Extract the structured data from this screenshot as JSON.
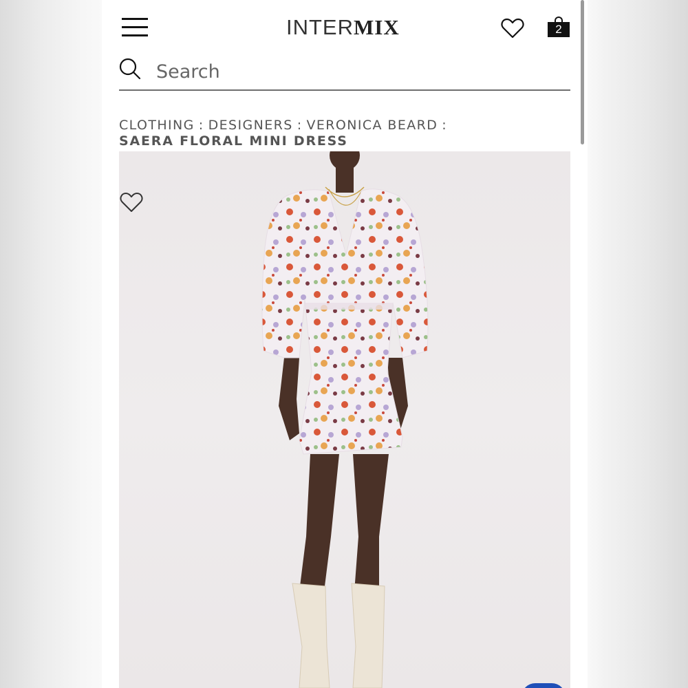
{
  "header": {
    "logo_part1": "INTER",
    "logo_part2": "MIX",
    "menu_icon": "hamburger-menu-icon",
    "wishlist_icon": "heart-outline-icon",
    "bag_icon": "shopping-bag-icon",
    "bag_count": "2"
  },
  "search": {
    "placeholder": "Search",
    "icon": "search-icon"
  },
  "breadcrumb": {
    "items": [
      "CLOTHING",
      "DESIGNERS",
      "VERONICA BEARD"
    ],
    "separator": ":"
  },
  "product": {
    "title": "SAERA FLORAL MINI DRESS",
    "wishlist_icon": "heart-outline-icon"
  },
  "colors": {
    "text": "#555555",
    "background": "#ffffff",
    "image_bg": "#ece8e9",
    "badge": "#1f4fb8"
  }
}
